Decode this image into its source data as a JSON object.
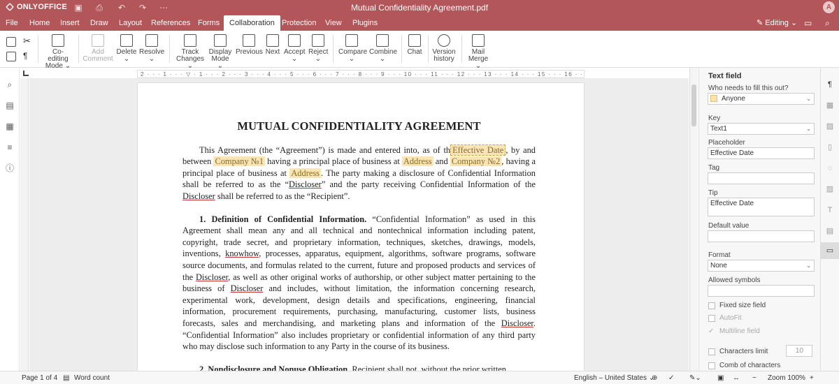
{
  "app": {
    "name": "ONLYOFFICE",
    "doc_title": "Mutual Confidentiality Agreement.pdf",
    "avatar_letter": "A"
  },
  "menu": {
    "tabs": [
      "File",
      "Home",
      "Insert",
      "Draw",
      "Layout",
      "References",
      "Forms",
      "Collaboration",
      "Protection",
      "View",
      "Plugins"
    ],
    "active": "Collaboration",
    "mode": "Editing"
  },
  "toolbar": {
    "coediting": [
      "Co-editing",
      "Mode"
    ],
    "add_comment": [
      "Add",
      "Comment"
    ],
    "delete": "Delete",
    "resolve": "Resolve",
    "track_changes": [
      "Track",
      "Changes"
    ],
    "display_mode": [
      "Display",
      "Mode"
    ],
    "previous": "Previous",
    "next": "Next",
    "accept": "Accept",
    "reject": "Reject",
    "compare": "Compare",
    "combine": "Combine",
    "chat": "Chat",
    "version_history": [
      "Version",
      "history"
    ],
    "mail_merge": [
      "Mail",
      "Merge"
    ]
  },
  "ruler": {
    "ticks": "2 · · · 1 · · · ▽ · 1 · · · 2 · · · 3 · · · 4 · · · 5 · · · 6 · · · 7 · · · 8 · · · 9 · · · 10 · · · 11 · · · 12 · · · 13 · · · 14 · · · 15 · · · 16 · · · ▽ · · 18 · · · 19"
  },
  "document": {
    "title": "MUTUAL CONFIDENTIALITY AGREEMENT",
    "p1": {
      "t1": "This Agreement (the “Agreement”) is made and entered into, as of th",
      "f_date": "Effective Date",
      "t2": ", by and between ",
      "f_company1": "Company №1",
      "t3": " having a principal place of business at ",
      "f_address1": "Address",
      "t4": " and ",
      "f_company2": "Company №2",
      "t5": ", having a principal place of business at ",
      "f_address2": "Address",
      "t6": ". The party making a disclosure of Confidential Information shall be referred to as the “",
      "u1": "Discloser",
      "t7": "” and the party receiving Confidential Information of the ",
      "u2": "Discloser",
      "t8": " shall be referred to as the “Recipient”."
    },
    "p2": {
      "heading": "1. Definition of Confidential Information.",
      "t1": " “Confidential Information” as used in this Agreement shall mean any and all technical and nontechnical information including patent, copyright, trade secret, and proprietary information, techniques, sketches, drawings, models, inventions, ",
      "u1": "knowhow",
      "t2": ", processes, apparatus, equipment, algorithms, software programs, software source documents, and formulas related to the current, future and proposed products and services of the ",
      "u2": "Discloser",
      "t3": ", as well as other original works of authorship, or other subject matter pertaining to the business of ",
      "u3": "Discloser",
      "t4": " and includes, without limitation, the information concerning research, experimental work, development, design details and specifications, engineering, financial information, procurement requirements, purchasing, manufacturing, customer lists, business forecasts, sales and merchandising, and marketing plans and information of the ",
      "u4": "Discloser",
      "t5": ". “Confidential Information” also includes proprietary or confidential information of any third party who may disclose such information to any Party in the course of its business."
    },
    "p3": {
      "heading": "2. Nondisclosure and Nonuse Obligation.",
      "t1": " Recipient shall not, without the prior written"
    }
  },
  "panel": {
    "title": "Text field",
    "who_label": "Who needs to fill this out?",
    "who_value": "Anyone",
    "key_label": "Key",
    "key_value": "Text1",
    "placeholder_label": "Placeholder",
    "placeholder_value": "Effective Date",
    "tag_label": "Tag",
    "tag_value": "",
    "tip_label": "Tip",
    "tip_value": "Effective Date",
    "default_label": "Default value",
    "default_value": "",
    "format_label": "Format",
    "format_value": "None",
    "allowed_label": "Allowed symbols",
    "allowed_value": "",
    "fixed_size": "Fixed size field",
    "autofit": "AutoFit",
    "multiline": "Multiline field",
    "chars_limit": "Characters limit",
    "chars_limit_value": "10",
    "comb": "Comb of characters"
  },
  "status": {
    "page": "Page 1 of 4",
    "word_count": "Word count",
    "language": "English – United States",
    "zoom": "Zoom 100%"
  },
  "colors": {
    "brand": "#b35659",
    "field_highlight": "#fae5b6"
  }
}
